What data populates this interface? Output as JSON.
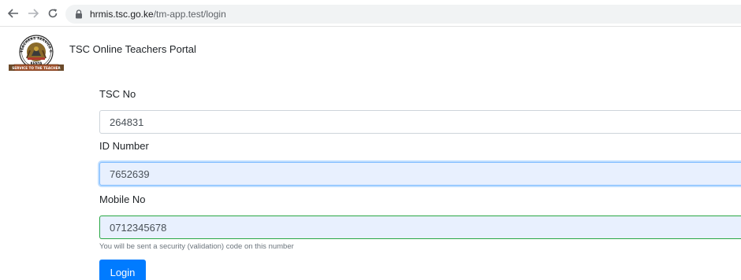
{
  "browser": {
    "url_host": "hrmis.tsc.go.ke",
    "url_path": "/tm-app.test/login"
  },
  "header": {
    "brand": "TSC Online Teachers Portal",
    "logo_text_top": "TEACHERS SERVICE COMMISSION",
    "logo_text_kenya": "KENYA",
    "logo_text_ribbon": "SERVICE TO THE TEACHER"
  },
  "form": {
    "tsc_no": {
      "label": "TSC No",
      "value": "264831"
    },
    "id_number": {
      "label": "ID Number",
      "value": "7652639"
    },
    "mobile_no": {
      "label": "Mobile No",
      "value": "0712345678",
      "help": "You will be sent a security (validation) code on this number"
    },
    "login_label": "Login"
  },
  "colors": {
    "primary": "#007bff",
    "valid": "#28a745",
    "autofill": "#e8f0fe",
    "focus": "#80bdff"
  },
  "icons": [
    "back-arrow-icon",
    "forward-arrow-icon",
    "reload-icon",
    "lock-icon",
    "tsc-logo"
  ]
}
